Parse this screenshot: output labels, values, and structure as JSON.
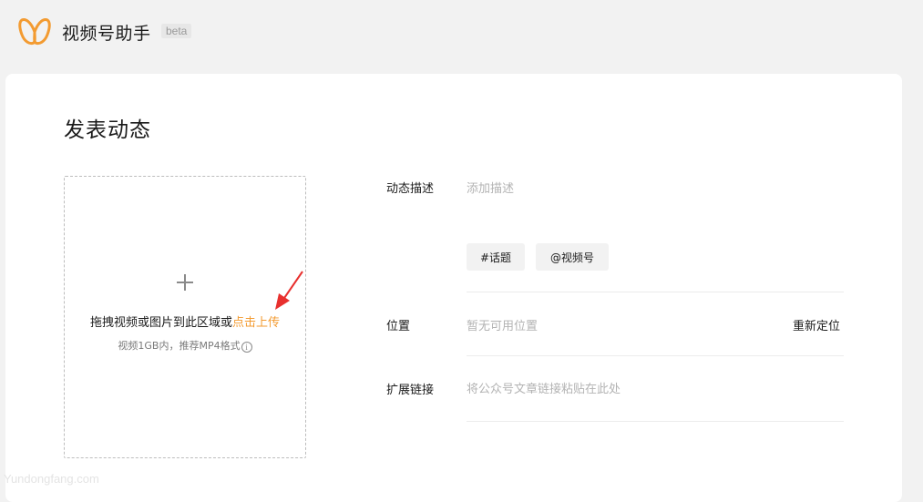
{
  "header": {
    "app_title": "视频号助手",
    "badge": "beta",
    "logo_icon": "butterfly-logo-icon",
    "logo_color": "#f39b31"
  },
  "page": {
    "title": "发表动态"
  },
  "upload": {
    "prompt": "拖拽视频或图片到此区域或",
    "link": "点击上传",
    "hint": "视频1GB内，推荐MP4格式",
    "info_glyph": "i",
    "link_color": "#f39b31"
  },
  "form": {
    "description": {
      "label": "动态描述",
      "placeholder": "添加描述"
    },
    "tags": {
      "topic_label": "#话题",
      "mention_label": "@视频号"
    },
    "location": {
      "label": "位置",
      "value": "暂无可用位置",
      "action": "重新定位"
    },
    "link": {
      "label": "扩展链接",
      "placeholder": "将公众号文章链接粘贴在此处"
    }
  },
  "watermark": "Yundongfang.com"
}
